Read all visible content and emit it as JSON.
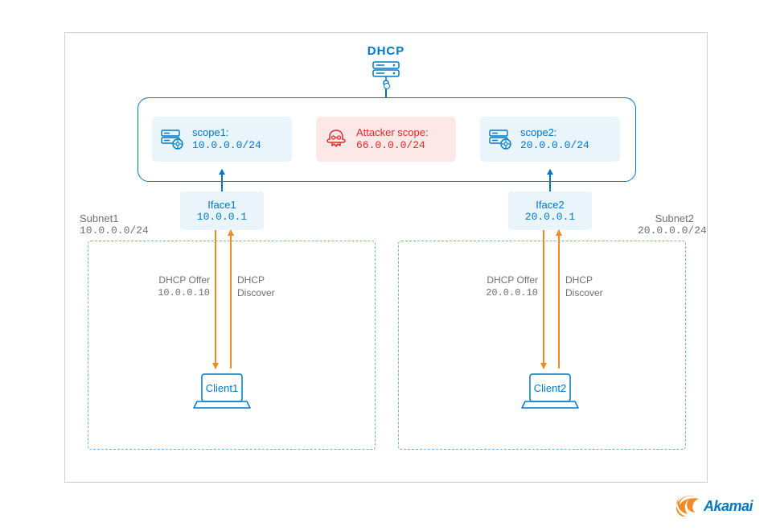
{
  "dhcp": {
    "label": "DHCP"
  },
  "scopes": {
    "scope1": {
      "title": "scope1:",
      "range": "10.0.0.0/24"
    },
    "attacker": {
      "title": "Attacker scope:",
      "range": "66.0.0.0/24"
    },
    "scope2": {
      "title": "scope2:",
      "range": "20.0.0.0/24"
    }
  },
  "ifaces": {
    "iface1": {
      "name": "Iface1",
      "ip": "10.0.0.1"
    },
    "iface2": {
      "name": "Iface2",
      "ip": "20.0.0.1"
    }
  },
  "subnets": {
    "subnet1": {
      "name": "Subnet1",
      "range": "10.0.0.0/24"
    },
    "subnet2": {
      "name": "Subnet2",
      "range": "20.0.0.0/24"
    }
  },
  "flows": {
    "offer_label": "DHCP Offer",
    "discover_label": "DHCP\nDiscover",
    "offer1_ip": "10.0.0.10",
    "offer2_ip": "20.0.0.10"
  },
  "clients": {
    "client1": "Client1",
    "client2": "Client2"
  },
  "logo": {
    "text": "Akamai"
  },
  "colors": {
    "primary_blue": "#0078c8",
    "light_blue_bg": "#e9f4fb",
    "danger_red": "#e02828",
    "light_red_bg": "#fde8e8",
    "arrow_orange": "#f08a24",
    "grey_text": "#707070"
  }
}
